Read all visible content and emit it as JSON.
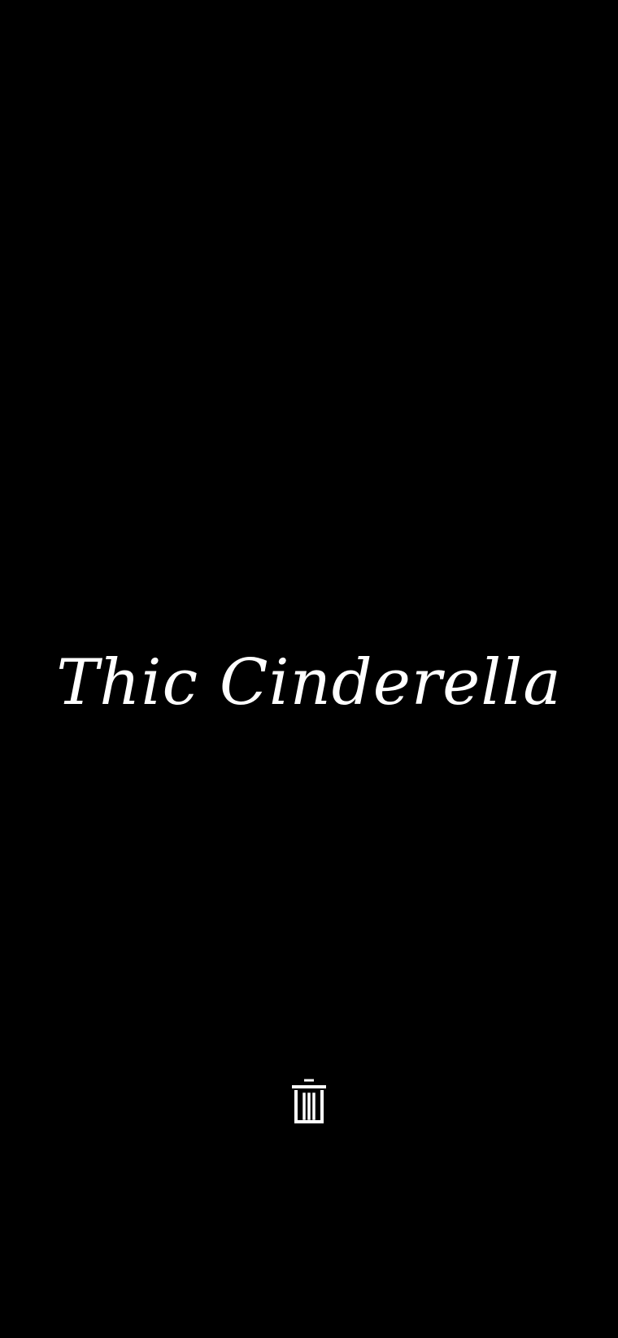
{
  "story": {
    "caption_text": "Thic Cinderella",
    "caption_color": "#ffffff",
    "background_color": "#000000"
  },
  "controls": {
    "delete_icon": "trash-icon"
  }
}
